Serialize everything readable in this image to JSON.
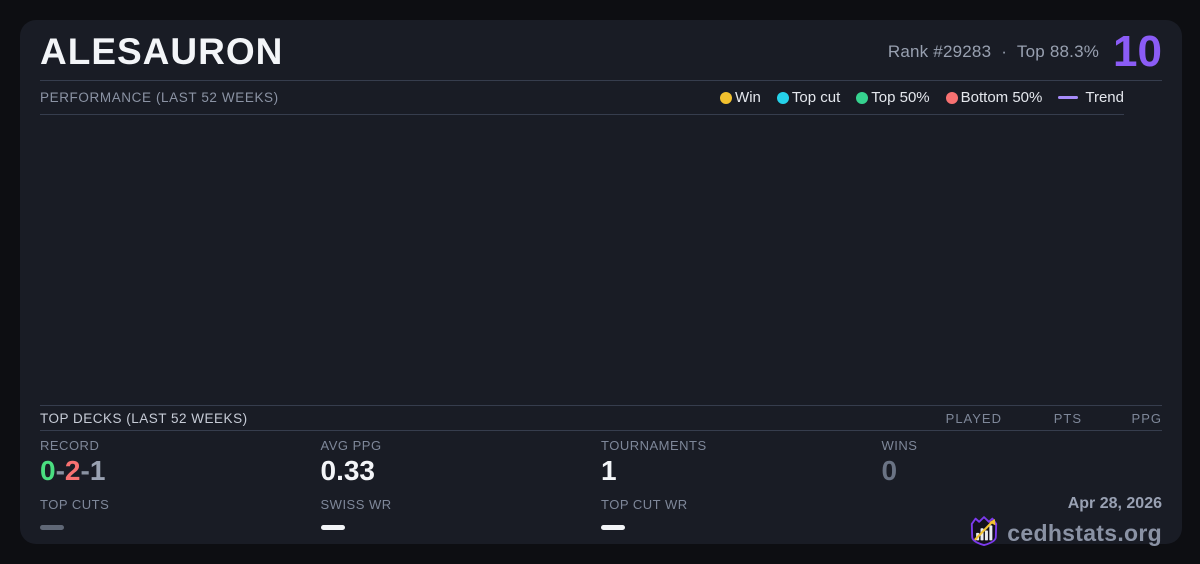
{
  "header": {
    "title": "ALESAURON",
    "rank_label": "Rank #29283",
    "separator": "·",
    "top_label": "Top 88.3%",
    "score": "10",
    "score_color": "#8b5cf6"
  },
  "performance": {
    "section_title": "PERFORMANCE (LAST 52 WEEKS)",
    "legend": [
      {
        "label": "Win",
        "color": "#f2c12e",
        "type": "dot"
      },
      {
        "label": "Top cut",
        "color": "#25d2ea",
        "type": "dot"
      },
      {
        "label": "Top 50%",
        "color": "#36d28f",
        "type": "dot"
      },
      {
        "label": "Bottom 50%",
        "color": "#f87171",
        "type": "dot"
      },
      {
        "label": "Trend",
        "color": "#a78bfa",
        "type": "line"
      }
    ],
    "chart": {
      "type": "scatter",
      "points": [],
      "note_empty": true
    }
  },
  "top_decks": {
    "section_title": "TOP DECKS (LAST 52 WEEKS)",
    "columns": [
      "PLAYED",
      "PTS",
      "PPG"
    ]
  },
  "stats": {
    "record": {
      "label": "RECORD",
      "parts": [
        {
          "text": "0",
          "color": "#4ade80"
        },
        {
          "text": "-",
          "color": "#8a92a2"
        },
        {
          "text": "2",
          "color": "#f87171"
        },
        {
          "text": "-",
          "color": "#8a92a2"
        },
        {
          "text": "1",
          "color": "#9aa2b2"
        }
      ]
    },
    "avg_ppg": {
      "label": "AVG PPG",
      "value": "0.33"
    },
    "tournaments": {
      "label": "TOURNAMENTS",
      "value": "1"
    },
    "wins": {
      "label": "WINS",
      "value": "0"
    },
    "top_cuts": {
      "label": "TOP CUTS",
      "dash_color": "#5f6776"
    },
    "swiss_wr": {
      "label": "SWISS WR",
      "dash_color": "#f2f4f7"
    },
    "top_cut_wr": {
      "label": "TOP CUT WR",
      "dash_color": "#f2f4f7"
    }
  },
  "footer": {
    "date": "Apr 28, 2026",
    "brand": "cedhstats.org",
    "logo_icon": "crown-barchart-arrow-icon",
    "logo_colors": {
      "shield": "#7c3aed",
      "bars": "#e8ebf0",
      "arrow": "#f1c232"
    }
  }
}
